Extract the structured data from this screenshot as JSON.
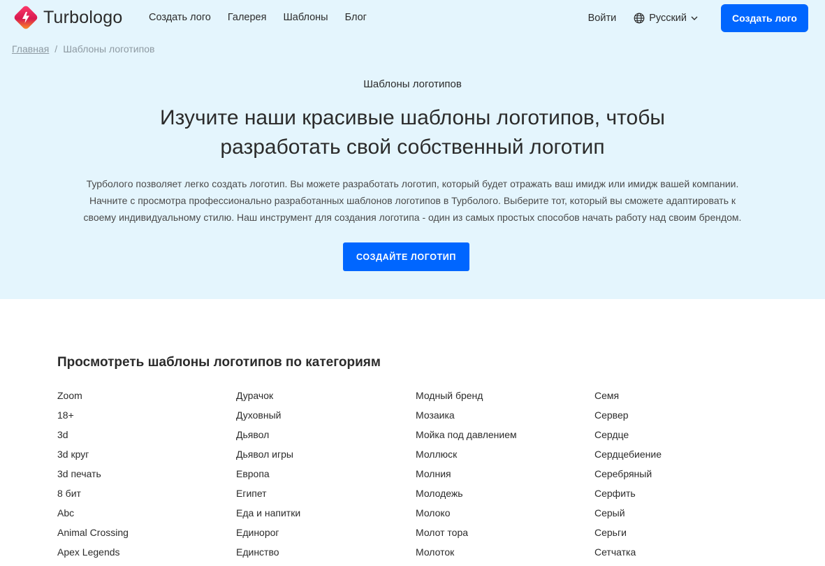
{
  "brand": {
    "name": "Turbologo"
  },
  "nav": {
    "items": [
      "Создать лого",
      "Галерея",
      "Шаблоны",
      "Блог"
    ],
    "login": "Войти",
    "language": "Русский",
    "cta": "Создать лого"
  },
  "breadcrumb": {
    "home": "Главная",
    "separator": "/",
    "current": "Шаблоны логотипов"
  },
  "hero": {
    "eyebrow": "Шаблоны логотипов",
    "title_line1": "Изучите наши красивые шаблоны логотипов, чтобы",
    "title_line2": "разработать свой собственный логотип",
    "desc_line1": "Турбологo позволяет легко создать логотип. Вы можете разработать логотип, который будет отражать ваш имидж или имидж вашей компании.",
    "desc_line2": "Начните с просмотра профессионально разработанных шаблонов логотипов в Турбологo. Выберите тот, который вы сможете адаптировать к",
    "desc_line3": "своему индивидуальному стилю. Наш инструмент для создания логотипа - один из самых простых способов начать работу над своим брендом.",
    "cta": "СОЗДАЙТЕ ЛОГОТИП"
  },
  "categories": {
    "title": "Просмотреть шаблоны логотипов по категориям",
    "columns": [
      [
        "Zoom",
        "18+",
        "3d",
        "3d круг",
        "3d печать",
        "8 бит",
        "Abc",
        "Animal Crossing",
        "Apex Legends"
      ],
      [
        "Дурачок",
        "Духовный",
        "Дьявол",
        "Дьявол игры",
        "Европа",
        "Египет",
        "Еда и напитки",
        "Единорог",
        "Единство"
      ],
      [
        "Модный бренд",
        "Мозаика",
        "Мойка под давлением",
        "Моллюск",
        "Молния",
        "Молодежь",
        "Молоко",
        "Молот тора",
        "Молоток"
      ],
      [
        "Семя",
        "Сервер",
        "Сердце",
        "Сердцебиение",
        "Серебряный",
        "Серфить",
        "Серый",
        "Серьги",
        "Сетчатка"
      ]
    ]
  },
  "colors": {
    "accent": "#0066ff",
    "hero_bg": "#e4f5fd",
    "text": "#2b2b2b",
    "muted": "#8e9aa2"
  }
}
